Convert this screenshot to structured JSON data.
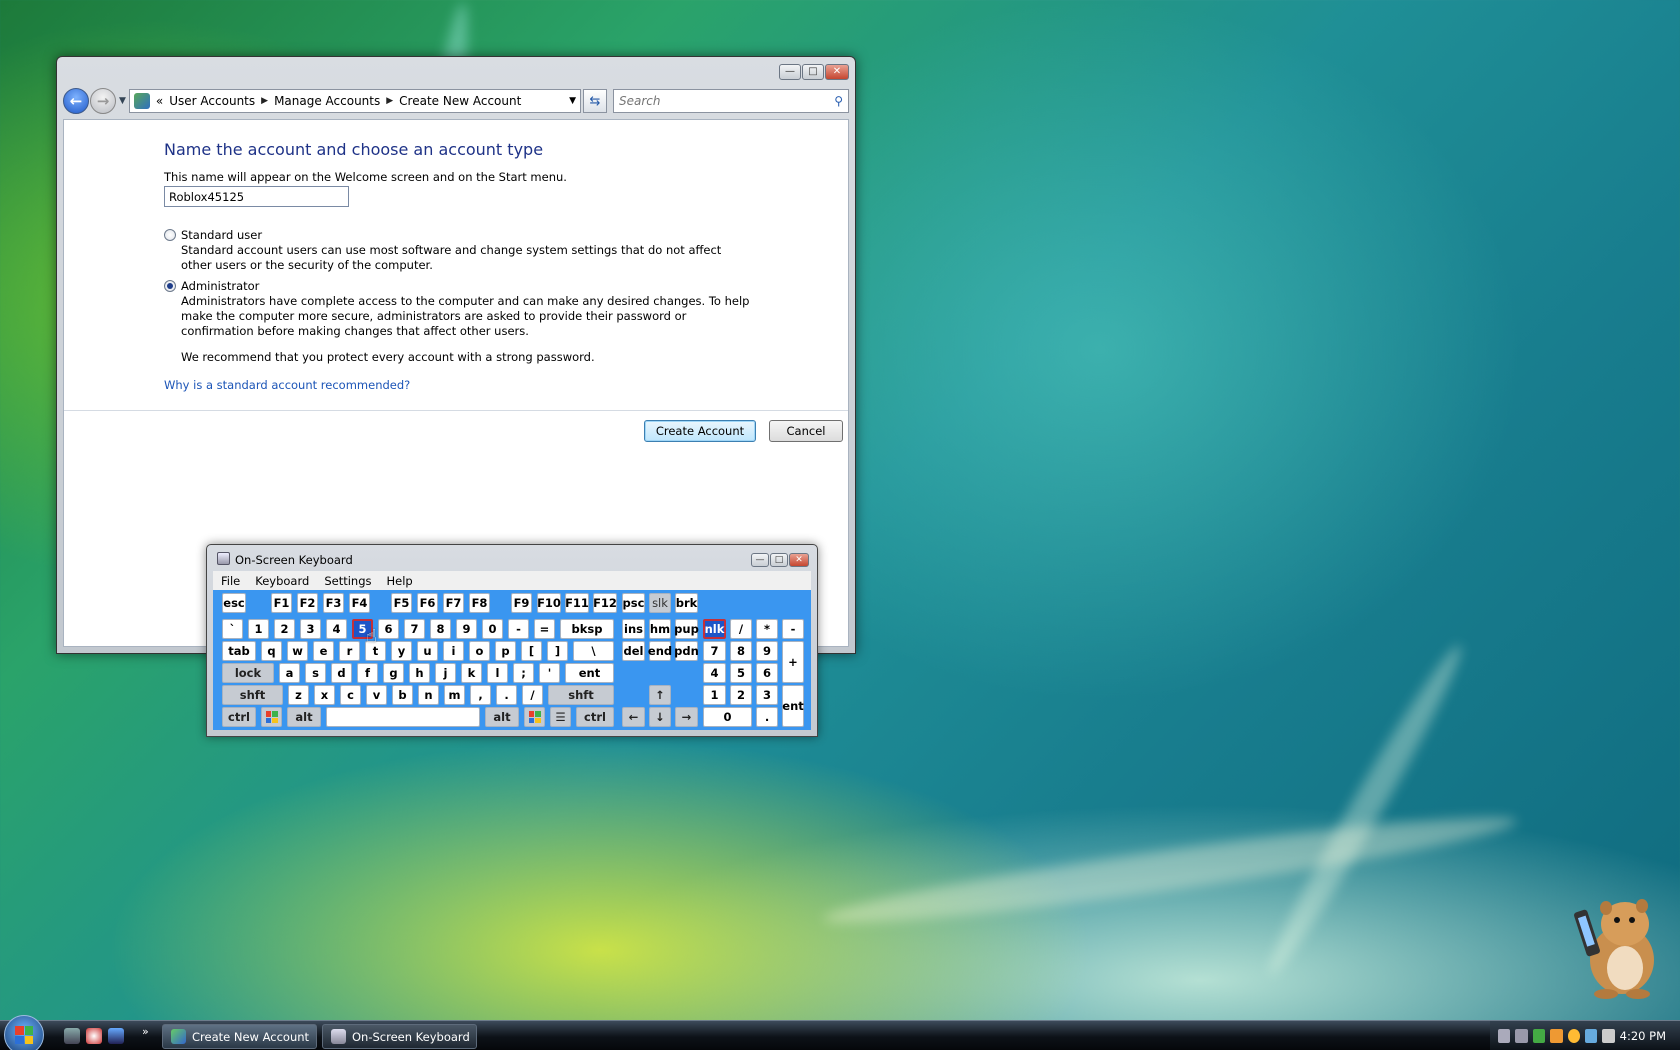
{
  "window": {
    "breadcrumb": [
      "User Accounts",
      "Manage Accounts",
      "Create New Account"
    ],
    "breadcrumb_prefix": "«",
    "search_placeholder": "Search"
  },
  "form": {
    "title": "Name the account and choose an account type",
    "name_description": "This name will appear on the Welcome screen and on the Start menu.",
    "name_value": "Roblox45125",
    "standard_label": "Standard user",
    "standard_desc": "Standard account users can use most software and change system settings that do not affect other users or the security of the computer.",
    "admin_label": "Administrator",
    "admin_desc": "Administrators have complete access to the computer and can make any desired changes. To help make the computer more secure, administrators are asked to provide their password or confirmation before making changes that affect other users.",
    "admin_recommend": "We recommend that you protect every account with a strong password.",
    "selected_type": "Administrator",
    "why_link": "Why is a standard account recommended?",
    "create_button": "Create Account",
    "cancel_button": "Cancel"
  },
  "osk": {
    "title": "On-Screen Keyboard",
    "menu": [
      "File",
      "Keyboard",
      "Settings",
      "Help"
    ],
    "active_key": "5",
    "toggled_key": "nlk"
  },
  "taskbar": {
    "tasks": [
      "Create New Account",
      "On-Screen Keyboard"
    ],
    "quicklaunch_more": "»",
    "clock": "4:20 PM"
  },
  "colors": {
    "title_blue": "#1e3287",
    "link_blue": "#1c55b7",
    "osk_background": "#3a96f0",
    "active_key": "#1d55c8"
  }
}
